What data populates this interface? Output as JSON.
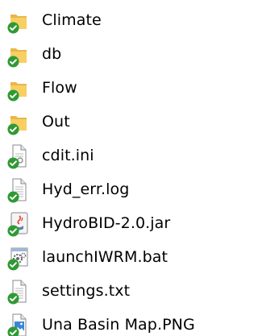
{
  "colors": {
    "folder": "#e9b64a",
    "folder_front": "#f7cf62",
    "sync_badge": "#2f9a34",
    "doc_line": "#b8b8b8"
  },
  "files": [
    {
      "name": "Climate",
      "icon": "folder-icon"
    },
    {
      "name": "db",
      "icon": "folder-icon"
    },
    {
      "name": "Flow",
      "icon": "folder-icon"
    },
    {
      "name": "Out",
      "icon": "folder-icon"
    },
    {
      "name": "cdit.ini",
      "icon": "config-file-icon"
    },
    {
      "name": "Hyd_err.log",
      "icon": "text-file-icon"
    },
    {
      "name": "HydroBID-2.0.jar",
      "icon": "java-file-icon"
    },
    {
      "name": "launchIWRM.bat",
      "icon": "batch-file-icon"
    },
    {
      "name": "settings.txt",
      "icon": "text-file-icon"
    },
    {
      "name": "Una Basin Map.PNG",
      "icon": "image-file-icon"
    }
  ]
}
